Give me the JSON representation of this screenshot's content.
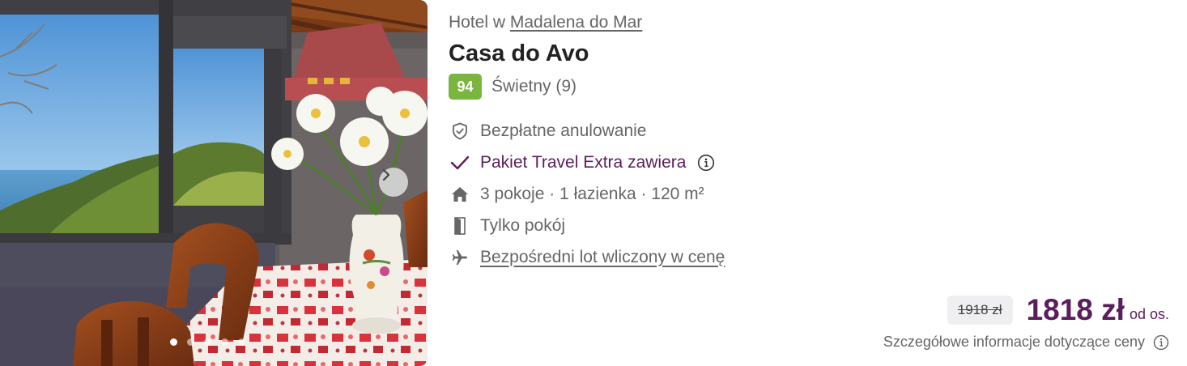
{
  "gallery": {
    "next_icon": "chevron-right-icon",
    "dots": [
      true,
      false,
      false,
      false,
      false
    ]
  },
  "hotel": {
    "subtitle_prefix": "Hotel w",
    "location": "Madalena do Mar",
    "name": "Casa do Avo",
    "score": "94",
    "score_color": "#7ab63f",
    "rating_text": "Świetny (9)"
  },
  "features": [
    {
      "icon": "shield-check-icon",
      "text": "Bezpłatne anulowanie"
    },
    {
      "icon": "checkmark-icon",
      "text": "Pakiet Travel Extra zawiera"
    },
    {
      "icon": "house-icon",
      "text": "3 pokoje · 1 łazienka · 120 m²"
    },
    {
      "icon": "door-icon",
      "text": "Tylko pokój"
    },
    {
      "icon": "airplane-icon",
      "text": "Bezpośredni lot wliczony w cenę"
    }
  ],
  "price": {
    "old": "1918 zł",
    "current": "1818 zł",
    "per": "od os.",
    "details": "Szczegółowe informacje dotyczące ceny",
    "accent_color": "#5b1d5b"
  }
}
